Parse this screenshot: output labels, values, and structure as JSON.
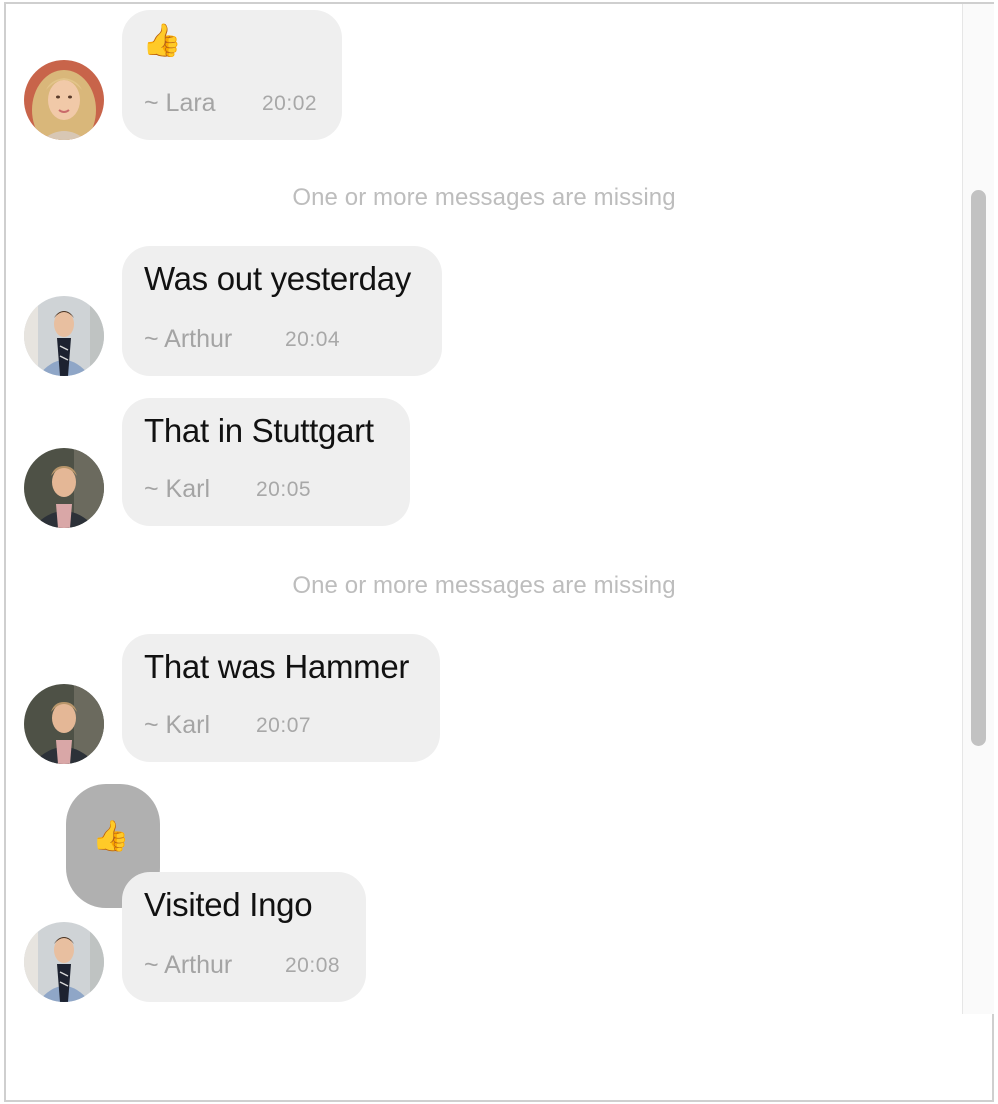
{
  "messages": [
    {
      "id": "m1",
      "type": "emoji",
      "content": "👍",
      "sender": "~ Lara",
      "time": "20:02",
      "avatar": "lara-avatar"
    },
    {
      "id": "m2",
      "type": "text",
      "content": "Was out yesterday",
      "sender": "~ Arthur",
      "time": "20:04",
      "avatar": "arthur-avatar"
    },
    {
      "id": "m3",
      "type": "text",
      "content": "That in Stuttgart",
      "sender": "~ Karl",
      "time": "20:05",
      "avatar": "karl-avatar"
    },
    {
      "id": "m4",
      "type": "text",
      "content": "That was Hammer",
      "sender": "~ Karl",
      "time": "20:07",
      "avatar": "karl-avatar"
    },
    {
      "id": "m5",
      "type": "text",
      "content": "Visited Ingo",
      "sender": "~ Arthur",
      "time": "20:08",
      "avatar": "arthur-avatar",
      "reaction": "👍"
    }
  ],
  "notices": {
    "missing_1": "One or more messages are missing",
    "missing_2": "One or more messages are missing"
  },
  "colors": {
    "bubble": "#efefef",
    "reaction_bubble": "#b0b0b0",
    "meta_text": "#a4a4a4",
    "notice_text": "#bdbdbd",
    "scroll_thumb": "#c2c2c2"
  }
}
